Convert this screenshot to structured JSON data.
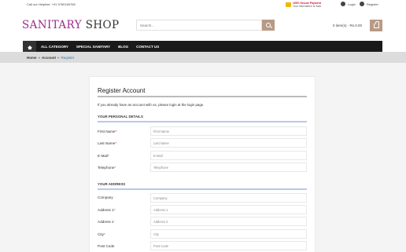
{
  "topbar": {
    "helpline": "Call our Helpline: +91 9760169765",
    "secure_line1": "100% Secure Payment",
    "secure_line2": "Your Information Is Safe",
    "login": "Login",
    "register": "Register"
  },
  "header": {
    "logo_part1": "SANITARY",
    "logo_part2": " SHOP",
    "search_placeholder": "Search...",
    "cart_text": "0 item(s) - Rs.0.00"
  },
  "nav": {
    "items": [
      "ALL CATEGORY",
      "SPECIAL SANITARY",
      "BLOG",
      "CONTACT US"
    ]
  },
  "breadcrumb": {
    "home": "Home",
    "sep": "»",
    "account": "Account",
    "current": "Register"
  },
  "form": {
    "title": "Register Account",
    "intro": "If you already have an account with us, please login at the login page.",
    "personal_heading": "YOUR PERSONAL DETAILS",
    "address_heading": "YOUR ADDRESS",
    "personal_fields": [
      {
        "label": "First Name",
        "required": "*",
        "placeholder": "First Name"
      },
      {
        "label": "Last Name",
        "required": "*",
        "placeholder": "Last Name"
      },
      {
        "label": "E-Mail",
        "required": "*",
        "placeholder": "E-Mail"
      },
      {
        "label": "Telephone",
        "required": "*",
        "placeholder": "Telephone"
      }
    ],
    "address_fields": [
      {
        "label": "Company",
        "required": "",
        "placeholder": "Company"
      },
      {
        "label": "Address 1",
        "required": "*",
        "placeholder": "Address 1"
      },
      {
        "label": "Address 2",
        "required": "",
        "placeholder": "Address 2"
      },
      {
        "label": "City",
        "required": "*",
        "placeholder": "City"
      },
      {
        "label": "Post Code",
        "required": "",
        "placeholder": "Post Code"
      }
    ]
  },
  "colors": {
    "logo_accent": "#9b2d8e",
    "button_bg": "#b79a86",
    "nav_bg": "#1a1a1a",
    "required": "#c8102e",
    "section_rule": "#b7c9ec"
  }
}
